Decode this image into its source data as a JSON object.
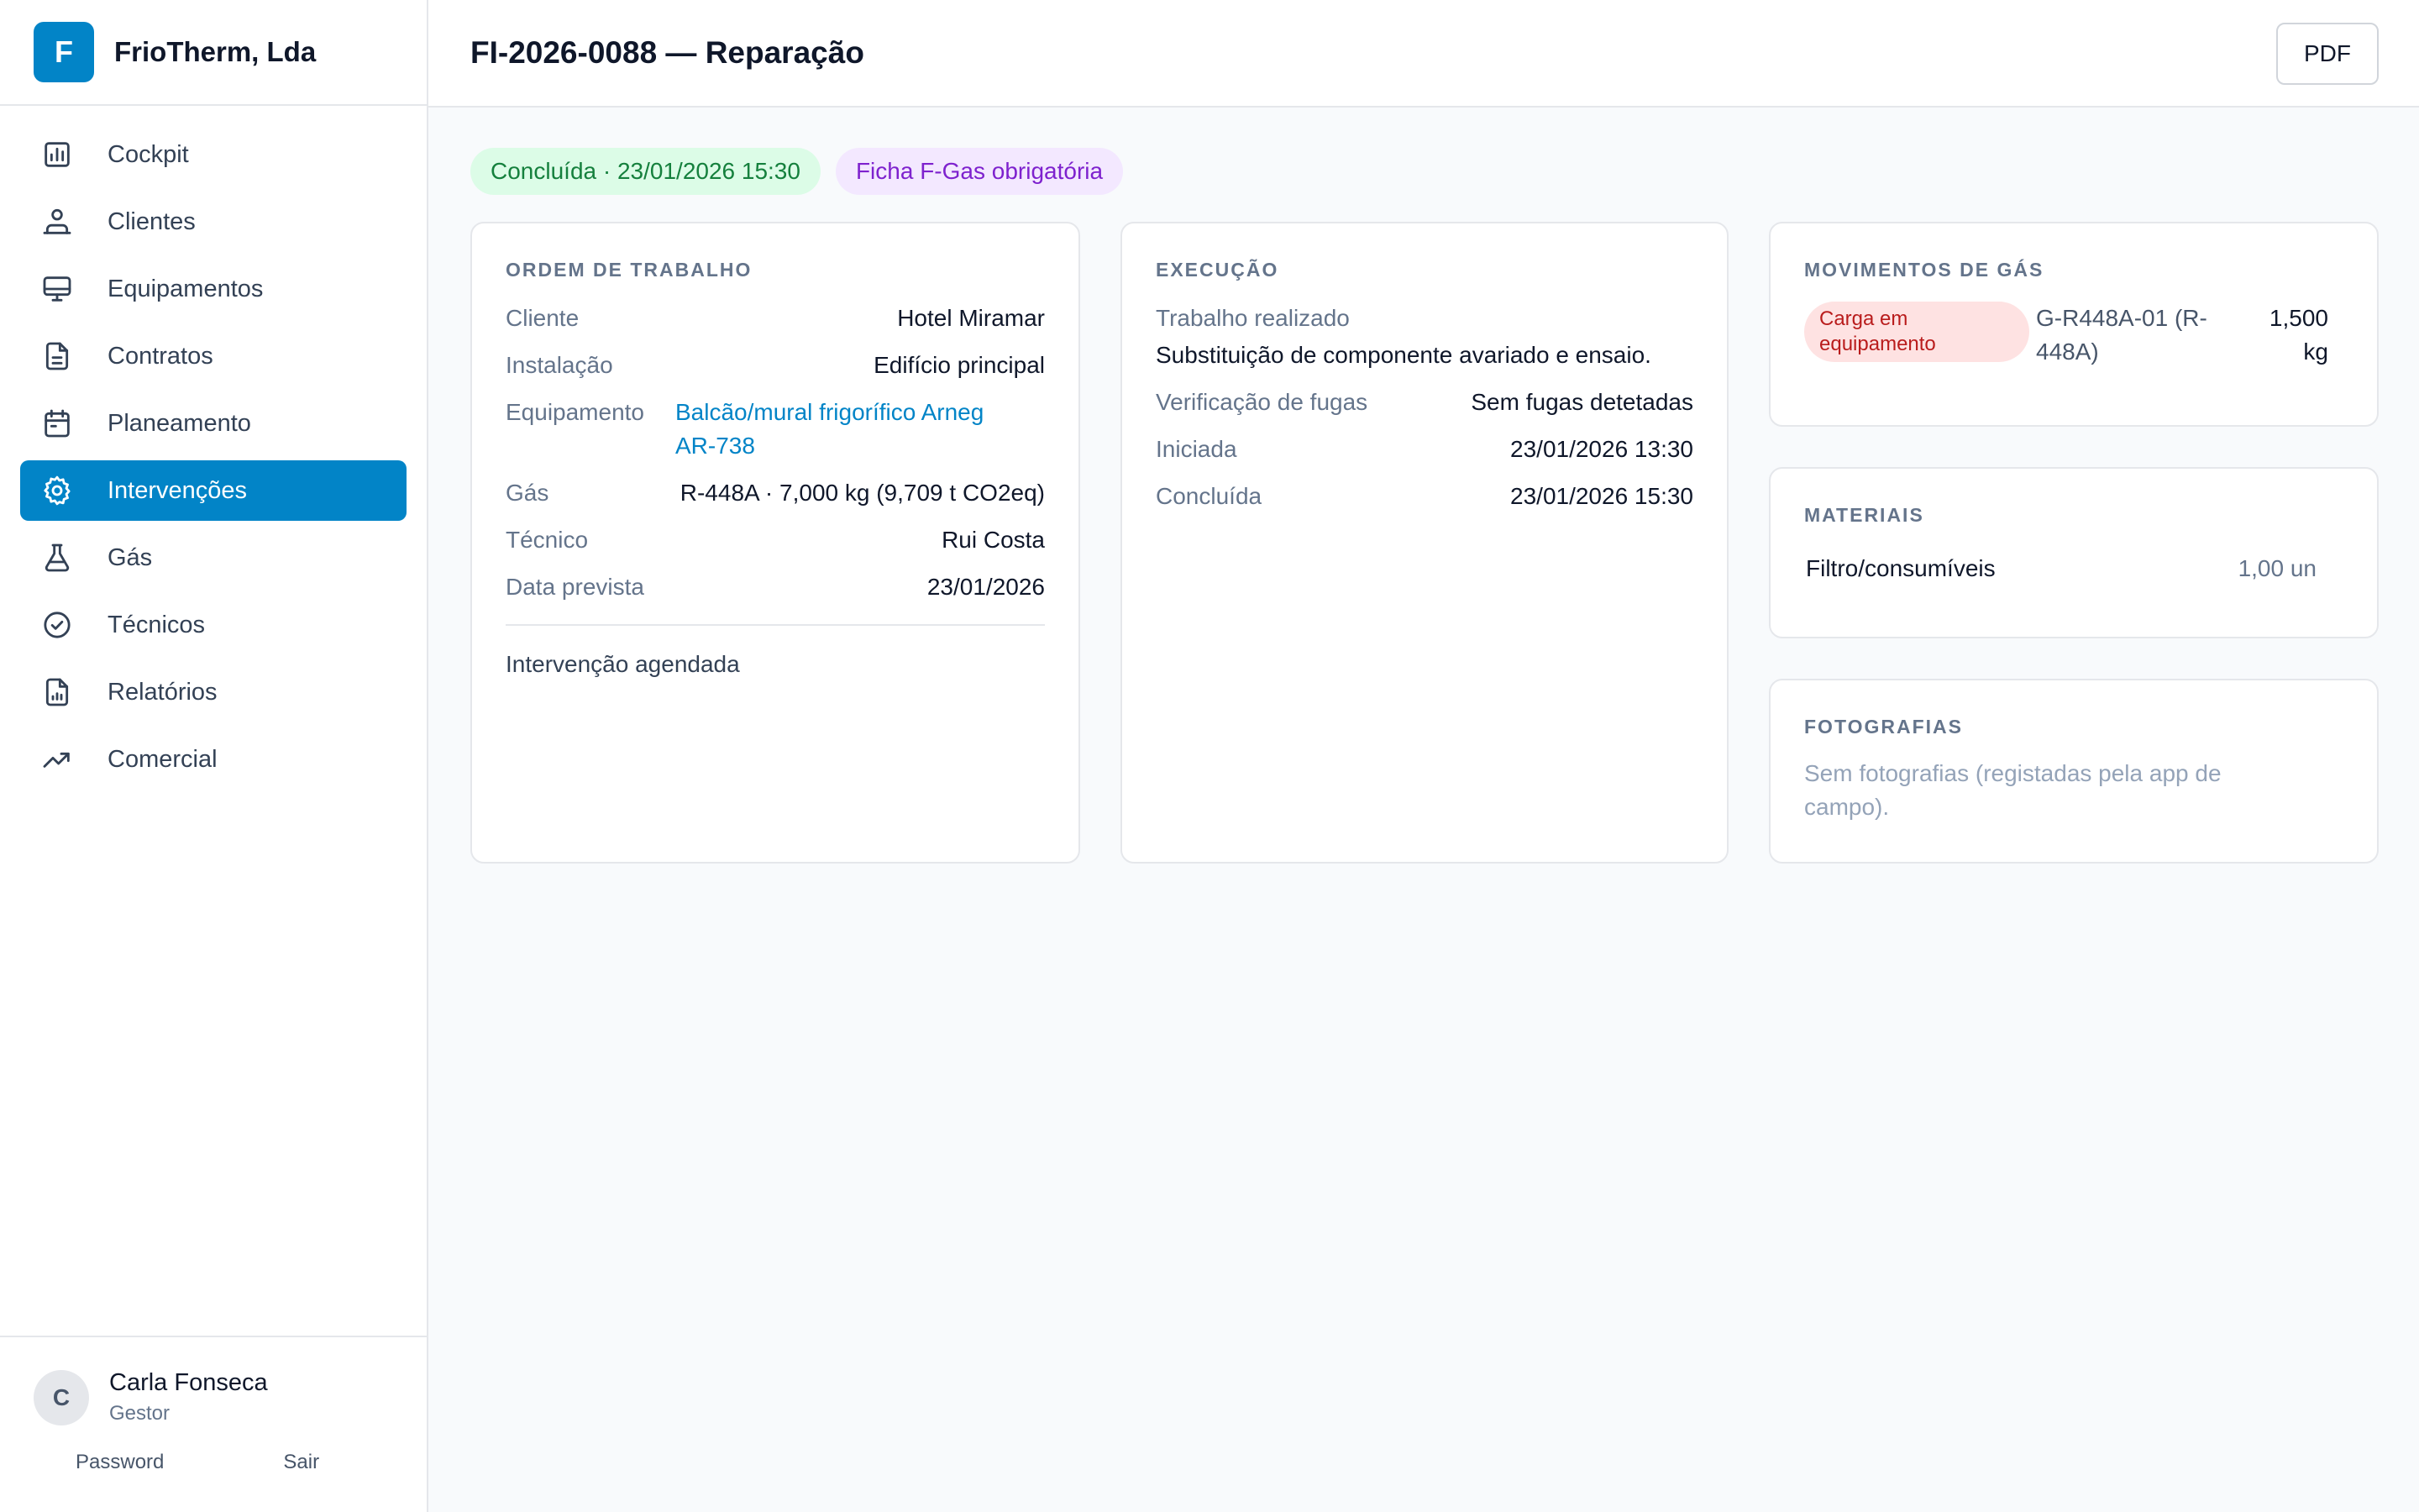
{
  "brand": {
    "initial": "F",
    "name": "FrioTherm, Lda"
  },
  "nav": [
    {
      "label": "Cockpit",
      "icon": "chart-bar-icon",
      "active": false
    },
    {
      "label": "Clientes",
      "icon": "users-icon",
      "active": false
    },
    {
      "label": "Equipamentos",
      "icon": "monitor-icon",
      "active": false
    },
    {
      "label": "Contratos",
      "icon": "document-icon",
      "active": false
    },
    {
      "label": "Planeamento",
      "icon": "calendar-icon",
      "active": false
    },
    {
      "label": "Intervenções",
      "icon": "gear-icon",
      "active": true
    },
    {
      "label": "Gás",
      "icon": "flask-icon",
      "active": false
    },
    {
      "label": "Técnicos",
      "icon": "check-circle-icon",
      "active": false
    },
    {
      "label": "Relatórios",
      "icon": "report-icon",
      "active": false
    },
    {
      "label": "Comercial",
      "icon": "trending-up-icon",
      "active": false
    }
  ],
  "user": {
    "initial": "C",
    "name": "Carla Fonseca",
    "role": "Gestor",
    "password_label": "Password",
    "logout_label": "Sair"
  },
  "header": {
    "title": "FI-2026-0088 — Reparação",
    "pdf_label": "PDF"
  },
  "badges": {
    "status": "Concluída · 23/01/2026 15:30",
    "fgas": "Ficha F-Gas obrigatória"
  },
  "work_order": {
    "title": "ORDEM DE TRABALHO",
    "client_label": "Cliente",
    "client_value": "Hotel Miramar",
    "installation_label": "Instalação",
    "installation_value": "Edifício principal",
    "equipment_label": "Equipamento",
    "equipment_value_line1": "Balcão/mural frigorífico Arneg",
    "equipment_value_line2": "AR-738",
    "gas_label": "Gás",
    "gas_value": "R-448A · 7,000 kg (9,709 t CO2eq)",
    "technician_label": "Técnico",
    "technician_value": "Rui Costa",
    "planned_date_label": "Data prevista",
    "planned_date_value": "23/01/2026",
    "note": "Intervenção agendada"
  },
  "execution": {
    "title": "EXECUÇÃO",
    "work_done_label": "Trabalho realizado",
    "work_done_value": "Substituição de componente avariado e ensaio.",
    "leak_check_label": "Verificação de fugas",
    "leak_check_value": "Sem fugas detetadas",
    "started_label": "Iniciada",
    "started_value": "23/01/2026 13:30",
    "completed_label": "Concluída",
    "completed_value": "23/01/2026 15:30"
  },
  "gas_movements": {
    "title": "MOVIMENTOS DE GÁS",
    "items": [
      {
        "type_line1": "Carga em",
        "type_line2": "equipamento",
        "cylinder_line1": "G-R448A-01 (R-",
        "cylinder_line2": "448A)",
        "qty_line1": "1,500",
        "qty_line2": "kg"
      }
    ]
  },
  "materials": {
    "title": "MATERIAIS",
    "items": [
      {
        "name": "Filtro/consumíveis",
        "qty": "1,00 un"
      }
    ]
  },
  "photos": {
    "title": "FOTOGRAFIAS",
    "empty_line1": "Sem fotografias (registadas pela app de",
    "empty_line2": "campo)."
  },
  "colors": {
    "accent": "#0284c7",
    "success_bg": "#dcfce7",
    "success_fg": "#15803d",
    "fgas_bg": "#f3e8ff",
    "fgas_fg": "#7e22ce",
    "danger_bg": "#fee2e2",
    "danger_fg": "#b91c1c"
  }
}
